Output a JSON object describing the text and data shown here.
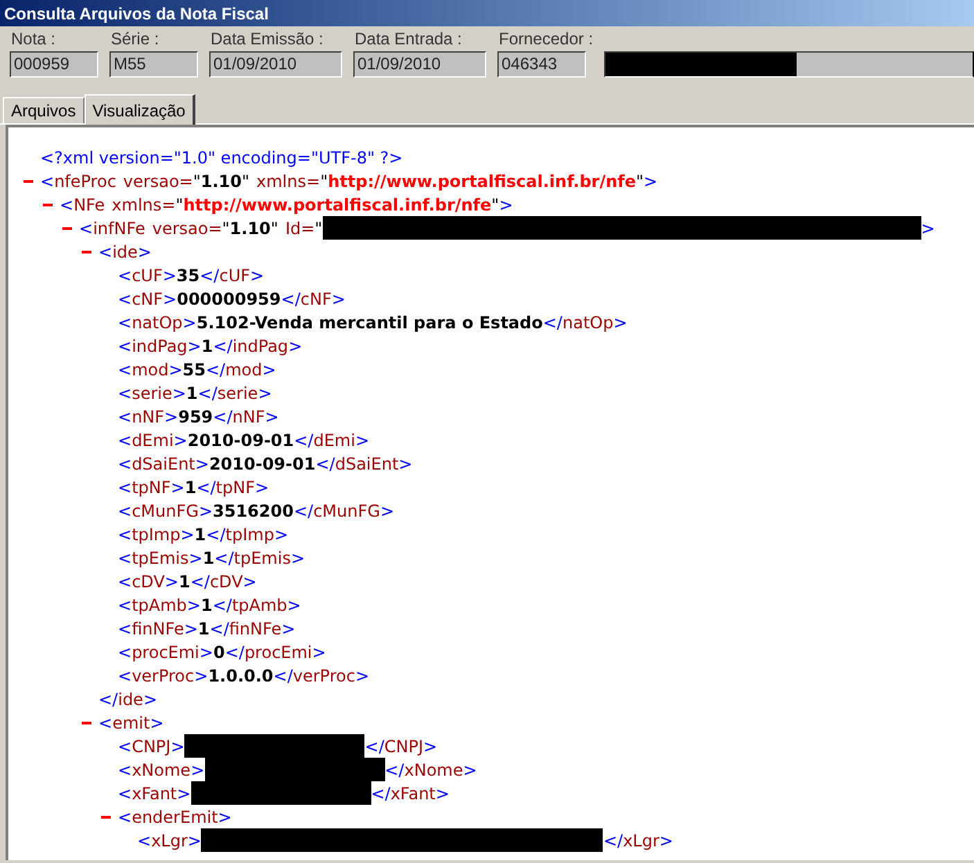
{
  "window": {
    "title": "Consulta Arquivos da Nota Fiscal"
  },
  "header": {
    "fields": [
      {
        "label": "Nota :",
        "value": "000959",
        "kind": "code"
      },
      {
        "label": "Série :",
        "value": "M55",
        "kind": "code"
      },
      {
        "label": "Data Emissão :",
        "value": "01/09/2010",
        "kind": "date"
      },
      {
        "label": "Data Entrada :",
        "value": "01/09/2010",
        "kind": "date"
      },
      {
        "label": "Fornecedor :",
        "value": "046343",
        "kind": "code"
      }
    ],
    "supplier_name": {
      "redacted": true
    }
  },
  "tabs": [
    {
      "label": "Arquivos",
      "selected": false
    },
    {
      "label": "Visualização",
      "selected": true
    }
  ],
  "xml": {
    "declaration": "<?xml version=\"1.0\" encoding=\"UTF-8\" ?>",
    "root": {
      "start": "<nfeProc",
      "attributes": [
        {
          "name": "versao=",
          "value": "\"1.10\"",
          "kind": "plain"
        },
        {
          "name": "xmlns=",
          "value": "\"http://www.portalfiscal.inf.br/nfe\"",
          "kind": "namespace"
        }
      ],
      "start_close": ">",
      "expanded": true,
      "children": [
        {
          "start": "<NFe",
          "attributes": [
            {
              "name": "xmlns=",
              "value": "\"http://www.portalfiscal.inf.br/nfe\"",
              "kind": "namespace"
            }
          ],
          "start_close": ">",
          "expanded": true,
          "children": [
            {
              "start": "<infNFe",
              "attributes": [
                {
                  "name": "versao=",
                  "value": "\"1.10\"",
                  "kind": "plain"
                },
                {
                  "name": "Id=",
                  "value": "\"",
                  "kind": "plain",
                  "redacted": true
                }
              ],
              "start_close": ">",
              "expanded": true,
              "children": [
                {
                  "start": "<ide>",
                  "expanded": true,
                  "close": "</ide>",
                  "children": [
                    {
                      "start": "<cUF>",
                      "text": "35",
                      "end": "</cUF>"
                    },
                    {
                      "start": "<cNF>",
                      "text": "000000959",
                      "end": "</cNF>"
                    },
                    {
                      "start": "<natOp>",
                      "text": "5.102-Venda mercantil para o Estado",
                      "end": "</natOp>"
                    },
                    {
                      "start": "<indPag>",
                      "text": "1",
                      "end": "</indPag>"
                    },
                    {
                      "start": "<mod>",
                      "text": "55",
                      "end": "</mod>"
                    },
                    {
                      "start": "<serie>",
                      "text": "1",
                      "end": "</serie>"
                    },
                    {
                      "start": "<nNF>",
                      "text": "959",
                      "end": "</nNF>"
                    },
                    {
                      "start": "<dEmi>",
                      "text": "2010-09-01",
                      "end": "</dEmi>"
                    },
                    {
                      "start": "<dSaiEnt>",
                      "text": "2010-09-01",
                      "end": "</dSaiEnt>"
                    },
                    {
                      "start": "<tpNF>",
                      "text": "1",
                      "end": "</tpNF>"
                    },
                    {
                      "start": "<cMunFG>",
                      "text": "3516200",
                      "end": "</cMunFG>"
                    },
                    {
                      "start": "<tpImp>",
                      "text": "1",
                      "end": "</tpImp>"
                    },
                    {
                      "start": "<tpEmis>",
                      "text": "1",
                      "end": "</tpEmis>"
                    },
                    {
                      "start": "<cDV>",
                      "text": "1",
                      "end": "</cDV>"
                    },
                    {
                      "start": "<tpAmb>",
                      "text": "1",
                      "end": "</tpAmb>"
                    },
                    {
                      "start": "<finNFe>",
                      "text": "1",
                      "end": "</finNFe>"
                    },
                    {
                      "start": "<procEmi>",
                      "text": "0",
                      "end": "</procEmi>"
                    },
                    {
                      "start": "<verProc>",
                      "text": "1.0.0.0",
                      "end": "</verProc>"
                    }
                  ]
                },
                {
                  "start": "<emit>",
                  "expanded": true,
                  "children": [
                    {
                      "start": "<CNPJ>",
                      "kind": "redacted",
                      "end": "</CNPJ>"
                    },
                    {
                      "start": "<xNome>",
                      "kind": "redacted",
                      "end": "</xNome>"
                    },
                    {
                      "start": "<xFant>",
                      "kind": "redacted",
                      "end": "</xFant>"
                    },
                    {
                      "start": "<enderEmit>",
                      "expanded": true,
                      "children": [
                        {
                          "start": "<xLgr>",
                          "kind": "redacted-wide",
                          "end": "</xLgr>"
                        }
                      ]
                    }
                  ]
                }
              ]
            }
          ]
        }
      ]
    }
  }
}
